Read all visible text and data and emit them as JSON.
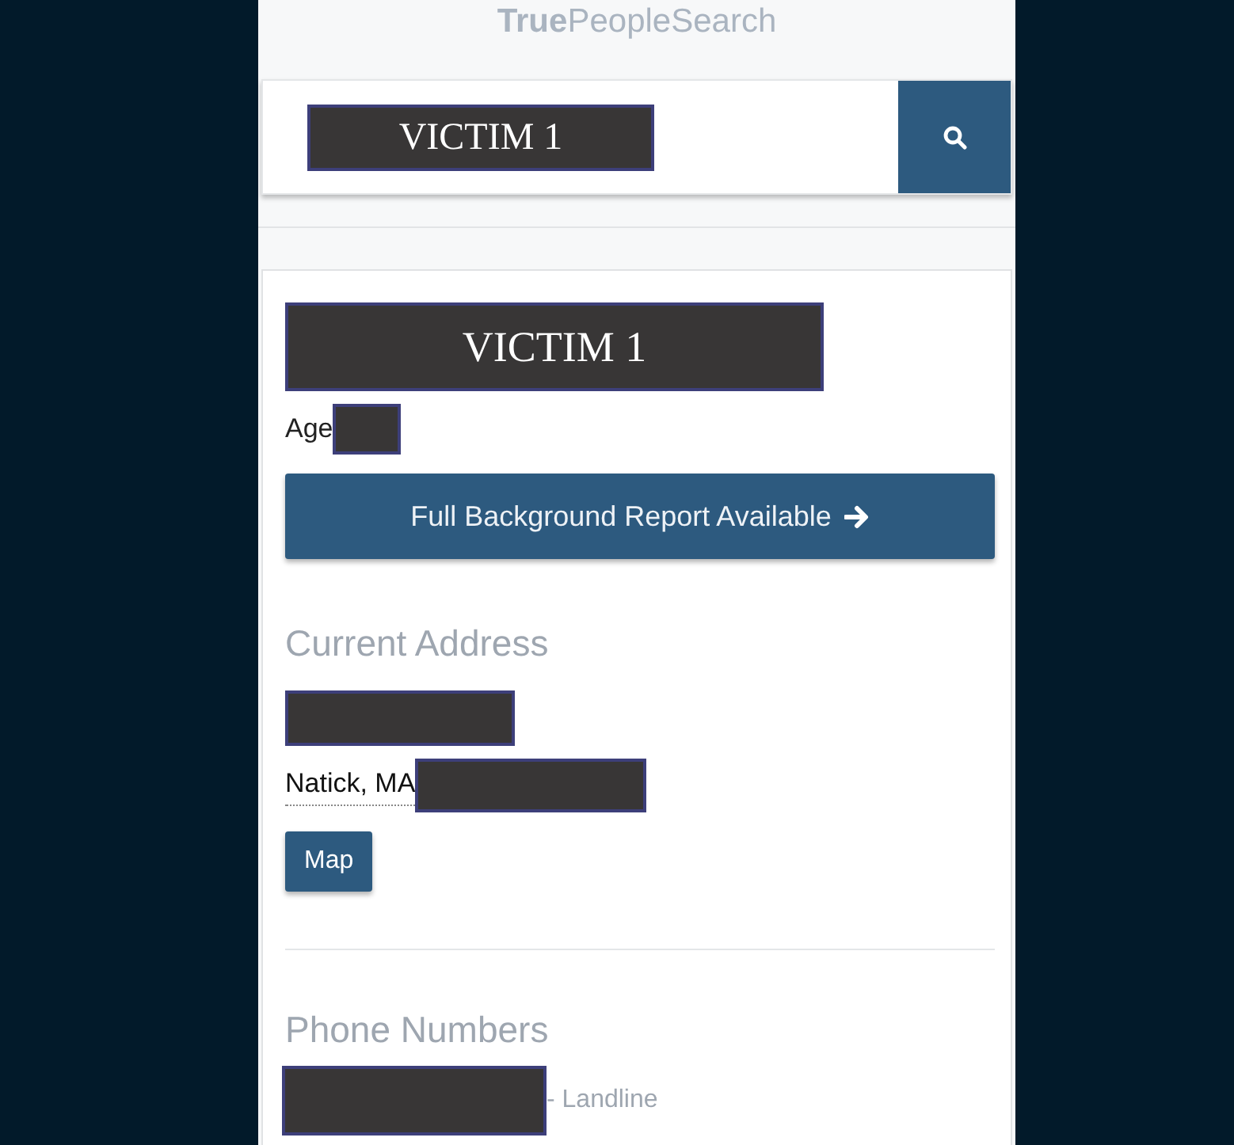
{
  "logo": "**True**PeopleSearch",
  "search": {
    "value": "VICTIM 1"
  },
  "person": {
    "name": "VICTIM 1",
    "age_label": "Age",
    "report_button": "Full Background Report Available"
  },
  "address": {
    "heading": "Current Address",
    "city": "Natick, MA",
    "map_button": "Map"
  },
  "phones": {
    "heading": "Phone Numbers",
    "items": [
      {
        "type": "- Landline"
      }
    ]
  }
}
